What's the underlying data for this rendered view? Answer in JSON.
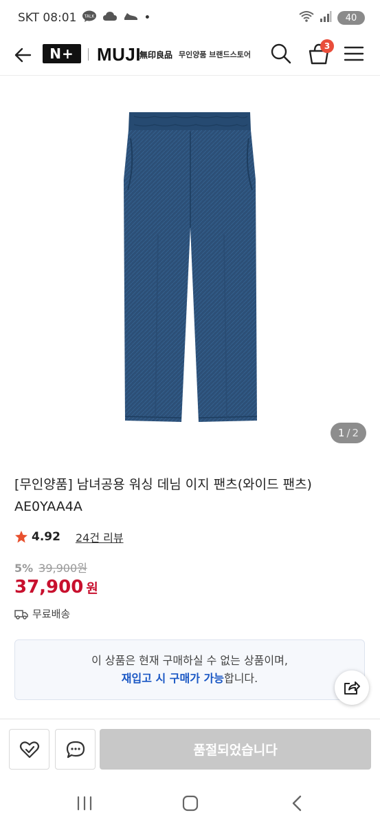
{
  "status_bar": {
    "carrier_time": "SKT 08:01",
    "talk_badge": "TALK",
    "dot": "•",
    "battery": "40"
  },
  "header": {
    "nplus_logo": "N+",
    "brand_logo": "MUJI",
    "brand_kanji": "無印良品",
    "store_name": "무인양품 브랜드스토어",
    "cart_count": "3"
  },
  "gallery": {
    "current": "1",
    "total": "2",
    "separator": "/"
  },
  "product": {
    "title_line1": "[무인양품] 남녀공용 워싱 데님 이지 팬츠(와이드 팬츠)",
    "title_line2": "AE0YAA4A",
    "rating": "4.92",
    "review_link": "24건 리뷰",
    "discount": "5%",
    "original_price": "39,900원",
    "sale_price": "37,900",
    "currency": "원",
    "shipping": "무료배송",
    "fabric_color": "#2c4f77"
  },
  "notice": {
    "line1": "이 상품은 현재 구매하실 수 없는 상품이며,",
    "line2_highlight": "재입고 시 구매가 가능",
    "line2_rest": "합니다."
  },
  "bottom_bar": {
    "soldout_label": "품절되었습니다"
  },
  "colors": {
    "price_red": "#c8102e",
    "link_blue": "#1a57c4",
    "badge_red": "#e94d3a",
    "star_orange": "#e8502e"
  }
}
